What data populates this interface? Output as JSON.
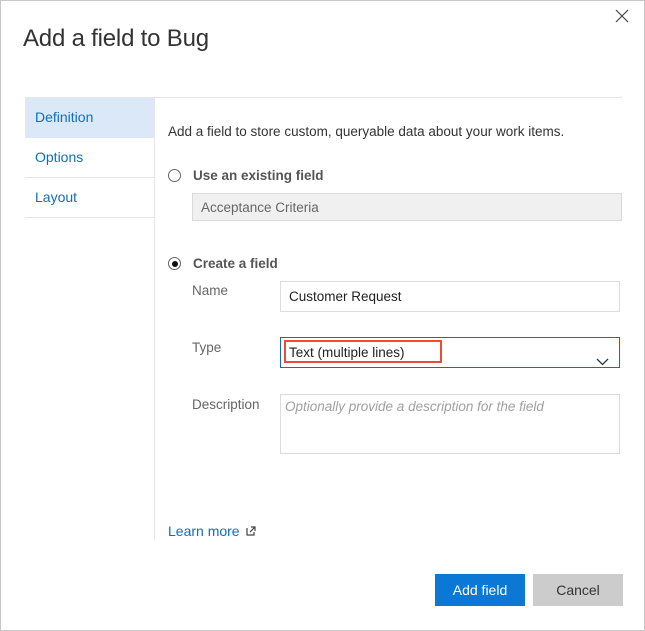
{
  "dialog": {
    "title": "Add a field to Bug",
    "close_icon": "close-icon"
  },
  "sidebar": {
    "items": [
      {
        "label": "Definition",
        "active": true
      },
      {
        "label": "Options",
        "active": false
      },
      {
        "label": "Layout",
        "active": false
      }
    ]
  },
  "main": {
    "intro": "Add a field to store custom, queryable data about your work items.",
    "existing": {
      "label": "Use an existing field",
      "selected": false,
      "value": "Acceptance Criteria"
    },
    "create": {
      "label": "Create a field",
      "selected": true,
      "name_label": "Name",
      "name_value": "Customer Request",
      "type_label": "Type",
      "type_value": "Text (multiple lines)",
      "description_label": "Description",
      "description_placeholder": "Optionally provide a description for the field"
    },
    "learn_more": "Learn more"
  },
  "footer": {
    "primary_label": "Add field",
    "secondary_label": "Cancel"
  },
  "colors": {
    "accent": "#0a78d4",
    "link": "#106ebe",
    "active_nav": "#dbe8f8",
    "highlight": "#e74c3c"
  }
}
